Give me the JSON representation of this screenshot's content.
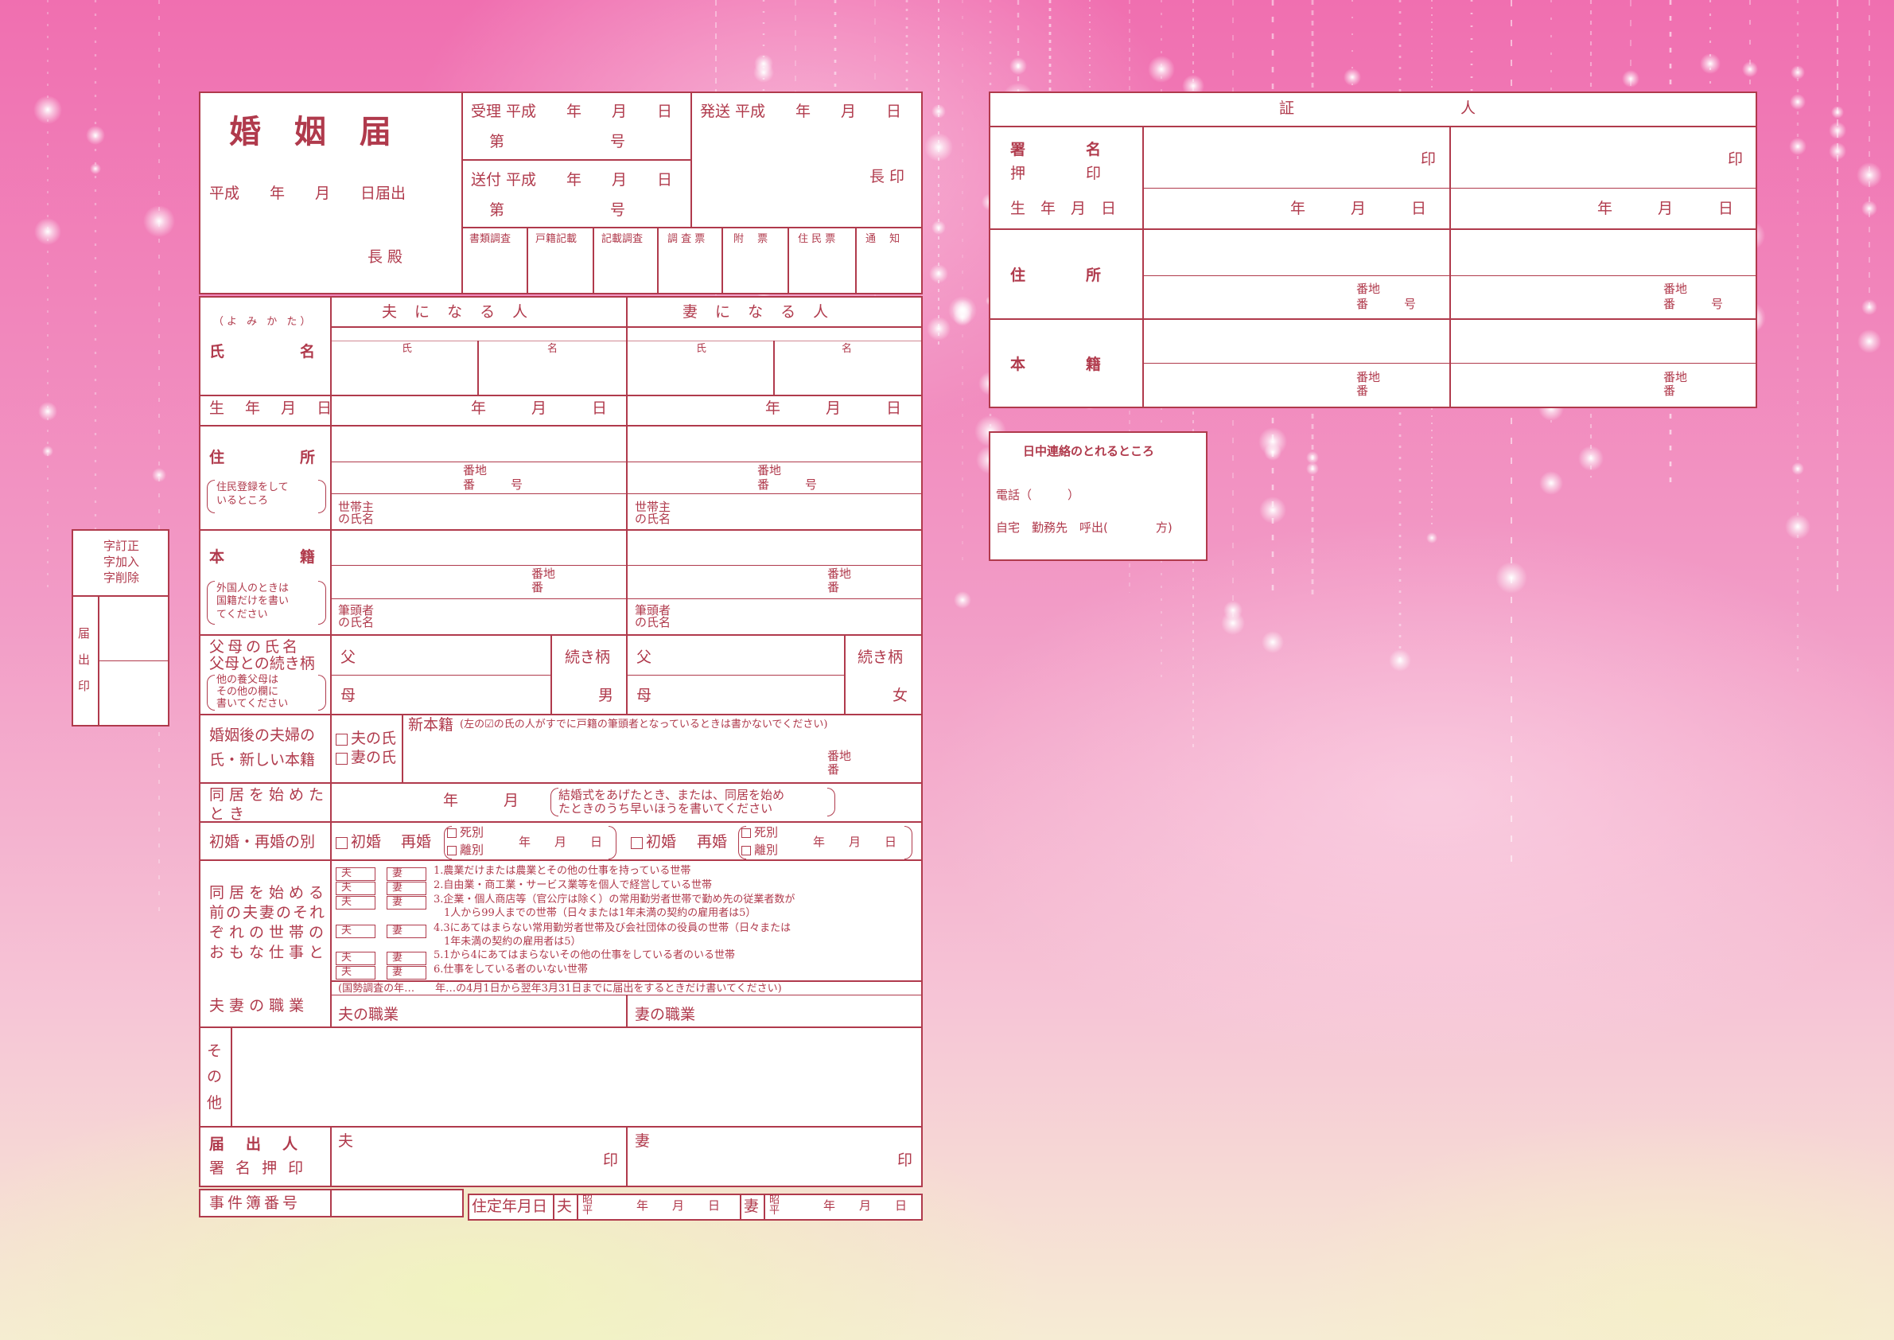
{
  "form": {
    "title": "婚 姻 届",
    "date_line": "平成　　年　　月　　日届出",
    "addressee": "長 殿",
    "receipt": {
      "accepted": "受理 平成　　年　　月　　日",
      "accepted_no": "第　　　　　　　号",
      "sent": "送付 平成　　年　　月　　日",
      "sent_no": "第　　　　　　　号",
      "dispatched": "発送 平成　　年　　月　　日",
      "chief_seal": "長 印"
    },
    "office_cells": [
      "書類調査",
      "戸籍記載",
      "記載調査",
      "調 査 票",
      "附　 票",
      "住 民 票",
      "通　 知"
    ],
    "col_husband": "夫 に な る 人",
    "col_wife": "妻 に な る 人",
    "yomikata": "（よ み か た）",
    "name_label": "氏　　　　　名",
    "surname": "氏",
    "given": "名",
    "birth_label": "生 年 月 日",
    "ymd": "年　　　月　　　日",
    "address_label": "住　　　　　所",
    "address_note": "住民登録をして いるところ",
    "banchi": "番地",
    "ban": "番",
    "go": "号",
    "household_head": "世帯主 の氏名",
    "honseki_label": "本　　　　　籍",
    "honseki_note": "外国人のときは 国籍だけを書い てください",
    "hittousha": "筆頭者 の氏名",
    "parents_label1": "父母の氏名",
    "parents_label2": "父母との続き柄",
    "parents_note": "他の養父母は その他の欄に 書いてください",
    "father": "父",
    "mother": "母",
    "relation": "続き柄",
    "son": "男",
    "daughter": "女",
    "new_surname_label1": "婚姻後の夫婦の",
    "new_surname_label2": "氏・新しい本籍",
    "husband_surname": "夫の氏",
    "wife_surname": "妻の氏",
    "new_honseki": "新本籍",
    "new_honseki_note": "(左の☑の氏の人がすでに戸籍の筆頭者となっているときは書かないでください)",
    "cohab_label": "同居を始めた とき",
    "cohab_date": "年　　　月",
    "cohab_note": "結婚式をあげたとき、または、同居を始め たときのうち早いほうを書いてください",
    "marriage_type_label": "初婚・再婚の別",
    "first_marriage": "初婚",
    "remarriage": "再婚",
    "bereaved": "死別",
    "divorced": "離別",
    "ymd_short": "年　　月　　日",
    "work_label": "同居を始める前の夫妻のそれぞれの世帯のおもな仕事と",
    "work_label_lines": [
      "同居を始める",
      "前の夫妻のそれ",
      "ぞれの世帯の",
      "おもな仕事と"
    ],
    "husband_tag": "夫",
    "wife_tag": "妻",
    "work_items": [
      "1.農業だけまたは農業とその他の仕事を持っている世帯",
      "2.自由業・商工業・サービス業等を個人で経営している世帯",
      "3.企業・個人商店等（官公庁は除く）の常用勤労者世帯で勤め先の従業者数が",
      "　1人から99人までの世帯（日々または1年未満の契約の雇用者は5）",
      "4.3にあてはまらない常用勤労者世帯及び会社団体の役員の世帯（日々または",
      "　1年未満の契約の雇用者は5）",
      "5.1から4にあてはまらないその他の仕事をしている者のいる世帯",
      "6.仕事をしている者のいない世帯"
    ],
    "occupation_label": "夫 妻 の 職 業",
    "occupation_note": "(国勢調査の年…　　年…の4月1日から翌年3月31日までに届出をするときだけ書いてください)",
    "husband_occupation": "夫の職業",
    "wife_occupation": "妻の職業",
    "other_label": "そ の 他",
    "notifier_label1": "届　出　人",
    "notifier_label2": "署 名 押 印",
    "husband": "夫",
    "wife": "妻",
    "seal": "印",
    "case_no_label": "事件簿番号",
    "residence_date_label": "住定年月日",
    "era_marks": "昭 平",
    "side_correction": [
      "字訂正",
      "字加入",
      "字削除"
    ],
    "side_seal": "届 出 印"
  },
  "witness": {
    "header": "証　　　　　　　　　　　人",
    "sign_label": "署　　　　名",
    "seal_label": "押　　　　印",
    "birth_label": "生　年　月　日",
    "address_label": "住　　　　所",
    "honseki_label": "本　　　　籍",
    "seal": "印",
    "ymd": "年　　　月　　　日",
    "banchi": "番地",
    "ban_go": "番　　　号",
    "ban": "番"
  },
  "contact": {
    "title": "日中連絡のとれるところ",
    "phone": "電話（　　　）",
    "options": "自宅　勤務先　呼出(　　　　方)"
  }
}
